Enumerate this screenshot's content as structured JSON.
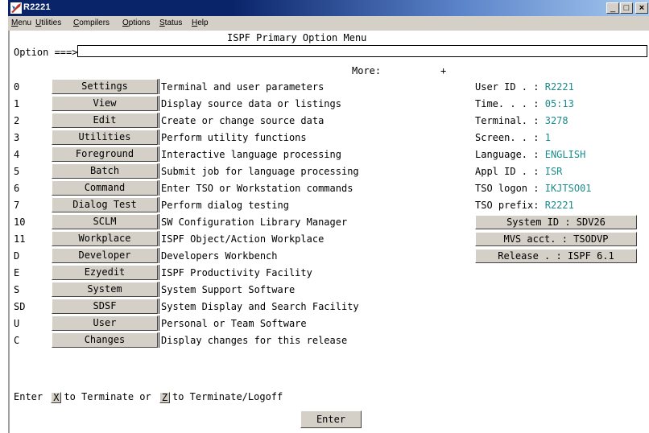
{
  "window": {
    "title": "R2221",
    "controls": {
      "minimize": "_",
      "maximize": "□",
      "close": "×"
    }
  },
  "menubar": [
    "Menu",
    "Utilities",
    "Compilers",
    "Options",
    "Status",
    "Help"
  ],
  "panel": {
    "title": "ISPF Primary Option Menu",
    "option_label": "Option ===>",
    "option_value": "",
    "more_label": "More:",
    "more_indicator": "+"
  },
  "options": [
    {
      "key": "0",
      "label": "Settings",
      "desc": "Terminal and user parameters"
    },
    {
      "key": "1",
      "label": "View",
      "desc": "Display source data or listings"
    },
    {
      "key": "2",
      "label": "Edit",
      "desc": "Create or change source data"
    },
    {
      "key": "3",
      "label": "Utilities",
      "desc": "Perform utility functions"
    },
    {
      "key": "4",
      "label": "Foreground",
      "desc": "Interactive language processing"
    },
    {
      "key": "5",
      "label": "Batch",
      "desc": "Submit job for language processing"
    },
    {
      "key": "6",
      "label": "Command",
      "desc": "Enter TSO or Workstation commands"
    },
    {
      "key": "7",
      "label": "Dialog Test",
      "desc": "Perform dialog testing"
    },
    {
      "key": "10",
      "label": "SCLM",
      "desc": "SW Configuration Library Manager"
    },
    {
      "key": "11",
      "label": "Workplace",
      "desc": "ISPF Object/Action Workplace"
    },
    {
      "key": "D",
      "label": "Developer",
      "desc": "Developers Workbench"
    },
    {
      "key": "E",
      "label": "Ezyedit",
      "desc": "ISPF Productivity Facility"
    },
    {
      "key": "S",
      "label": "System",
      "desc": "System Support Software"
    },
    {
      "key": "SD",
      "label": "SDSF",
      "desc": "System Display and Search Facility"
    },
    {
      "key": "U",
      "label": "User",
      "desc": "Personal or Team Software"
    },
    {
      "key": "C",
      "label": "Changes",
      "desc": "Display changes for this release"
    }
  ],
  "info": [
    {
      "label": "User ID . :",
      "value": "R2221"
    },
    {
      "label": "Time. . . :",
      "value": "05:13"
    },
    {
      "label": "Terminal. :",
      "value": "3278"
    },
    {
      "label": "Screen. . :",
      "value": "1"
    },
    {
      "label": "Language. :",
      "value": "ENGLISH"
    },
    {
      "label": "Appl ID . :",
      "value": "ISR"
    },
    {
      "label": "TSO logon :",
      "value": "IKJTSO01"
    },
    {
      "label": "TSO prefix:",
      "value": "R2221"
    }
  ],
  "system_buttons": [
    "System ID : SDV26",
    "MVS acct. : TSODVP",
    "Release . : ISPF 6.1"
  ],
  "footer": {
    "enter_text": "Enter",
    "key_x": "X",
    "terminate_text": "to Terminate or",
    "key_z": "Z",
    "logoff_text": "to Terminate/Logoff",
    "enter_button": "Enter"
  },
  "colors": {
    "title_bar": "#0a246a",
    "info_value": "#1a8c8c",
    "button_face": "#d4d0c8"
  }
}
